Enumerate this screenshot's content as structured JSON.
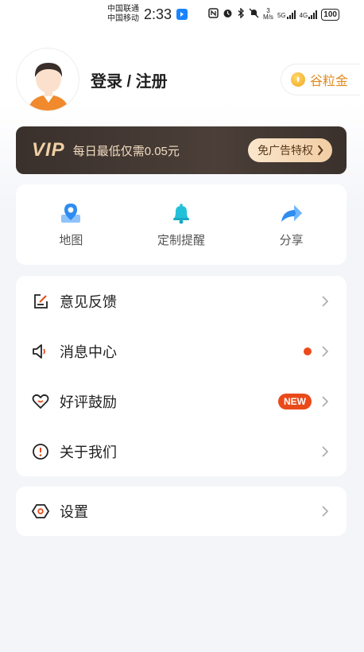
{
  "status_bar": {
    "carrier1": "中国联通",
    "carrier2": "中国移动",
    "time": "2:33",
    "speed_value": "3",
    "speed_unit": "M/s",
    "net1": "5G",
    "net2": "4G",
    "battery": "100"
  },
  "profile": {
    "login_label": "登录 / 注册",
    "coin_label": "谷粒金"
  },
  "vip": {
    "logo": "VIP",
    "tagline": "每日最低仅需0.05元",
    "button_label": "免广告特权"
  },
  "quick_actions": [
    {
      "label": "地图",
      "icon": "map-pin-icon"
    },
    {
      "label": "定制提醒",
      "icon": "bell-icon"
    },
    {
      "label": "分享",
      "icon": "share-arrow-icon"
    }
  ],
  "menu": [
    {
      "label": "意见反馈",
      "icon": "edit-feedback-icon"
    },
    {
      "label": "消息中心",
      "icon": "speaker-icon"
    },
    {
      "label": "好评鼓励",
      "icon": "heart-icon",
      "badge": "NEW"
    },
    {
      "label": "关于我们",
      "icon": "info-alert-icon"
    }
  ],
  "settings": {
    "label": "设置",
    "icon": "hexagon-settings-icon"
  },
  "colors": {
    "accent_orange": "#ea4a19",
    "coin_orange": "#e28a1d",
    "vip_dark": "#3a302c",
    "icon_blue": "#2f8cf0",
    "icon_cyan": "#22c1d9"
  }
}
